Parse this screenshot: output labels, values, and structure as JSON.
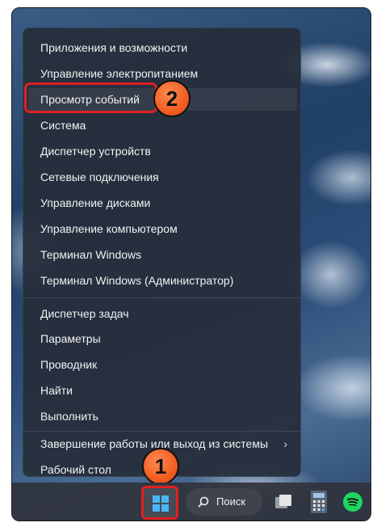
{
  "start_menu": {
    "items": [
      "Приложения и возможности",
      "Управление электропитанием",
      "Просмотр событий",
      "Система",
      "Диспетчер устройств",
      "Сетевые подключения",
      "Управление дисками",
      "Управление компьютером",
      "Терминал Windows",
      "Терминал Windows (Администратор)",
      "Диспетчер задач",
      "Параметры",
      "Проводник",
      "Найти",
      "Выполнить",
      "Завершение работы или выход из системы",
      "Рабочий стол"
    ],
    "submenu_chevron": "›"
  },
  "callouts": {
    "step1": "1",
    "step2": "2"
  },
  "taskbar": {
    "search_label": "Поиск",
    "icons": [
      "windows-start-icon",
      "search-icon",
      "task-view-icon",
      "calculator-icon",
      "spotify-icon"
    ]
  },
  "colors": {
    "highlight_red": "#e02020",
    "callout_orange": "#f05a1e",
    "windows_blue": "#49b5f5",
    "spotify_green": "#1ed760"
  }
}
